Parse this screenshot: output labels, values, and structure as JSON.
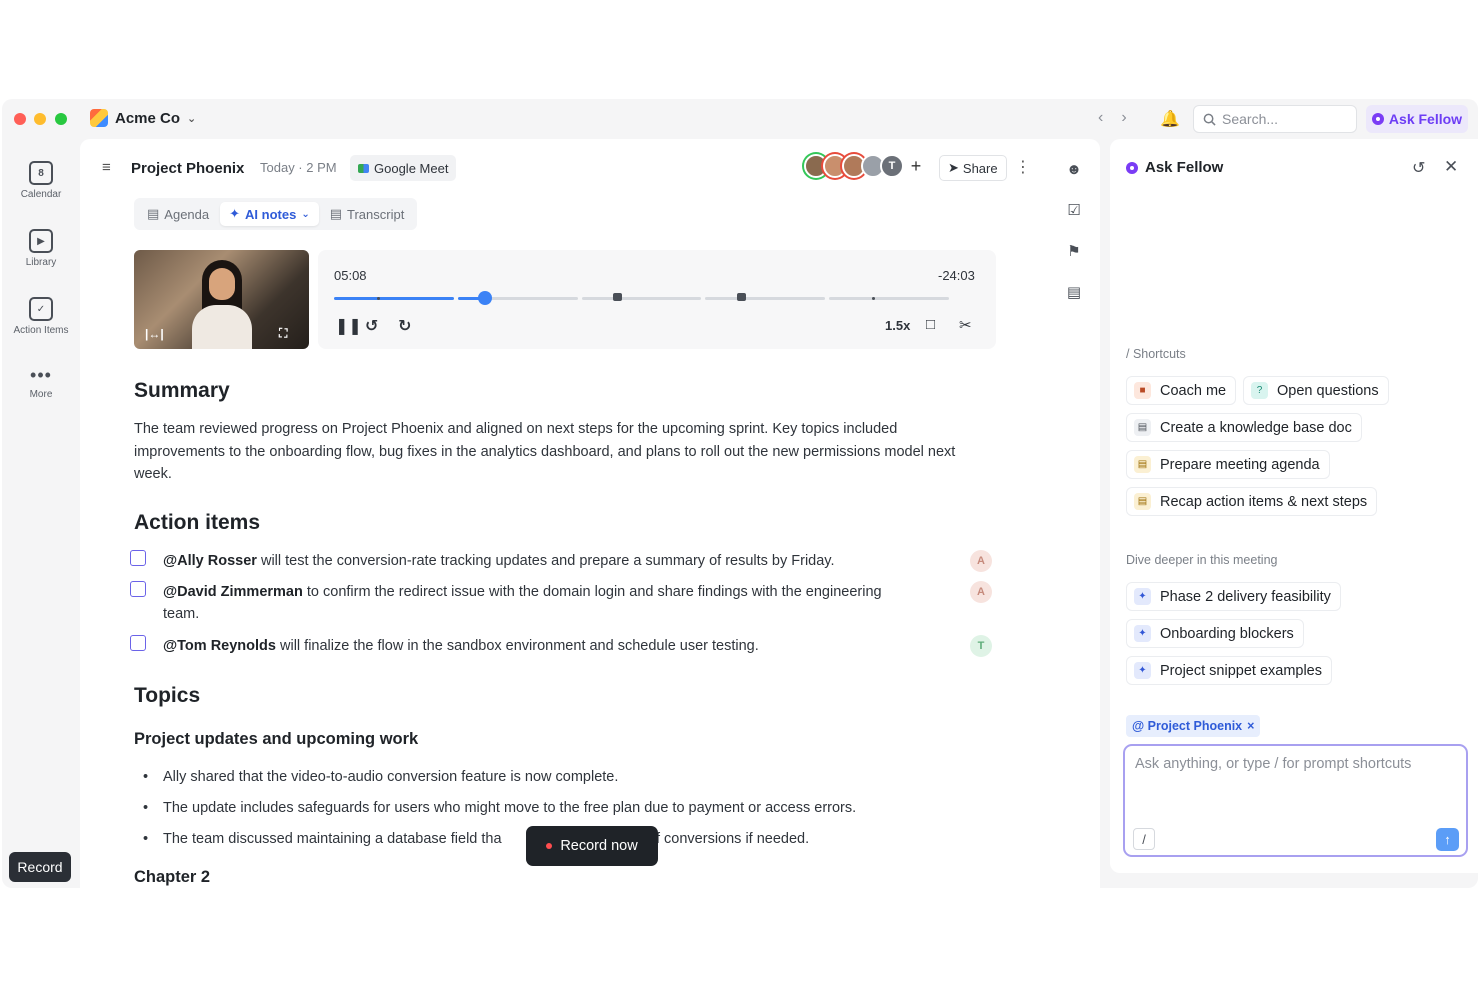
{
  "titlebar": {
    "org_name": "Acme Co",
    "search_placeholder": "Search...",
    "ask_button": "Ask Fellow"
  },
  "rail": {
    "items": [
      {
        "label": "Calendar",
        "icon": "calendar-icon",
        "badge": "8"
      },
      {
        "label": "Library",
        "icon": "library-icon"
      },
      {
        "label": "Action Items",
        "icon": "checkbox-icon"
      },
      {
        "label": "More",
        "icon": "more-dots-icon"
      }
    ],
    "record_button": "Record"
  },
  "meeting": {
    "title": "Project Phoenix",
    "time": "Today · 2 PM",
    "platform": "Google Meet",
    "avatar_initial": "T",
    "share_label": "Share"
  },
  "tabs": [
    {
      "label": "Agenda",
      "active": false
    },
    {
      "label": "AI notes",
      "active": true
    },
    {
      "label": "Transcript",
      "active": false
    }
  ],
  "player": {
    "elapsed": "05:08",
    "remaining": "-24:03",
    "speed": "1.5x",
    "progress": 0.24
  },
  "summary": {
    "heading": "Summary",
    "text": "The team reviewed progress on Project Phoenix and aligned on next steps for the upcoming sprint. Key topics included improvements to the onboarding flow, bug fixes in the analytics dashboard, and plans to roll out the new permissions model next week."
  },
  "action_items": {
    "heading": "Action items",
    "items": [
      {
        "mention": "@Ally Rosser",
        "text": " will test the conversion-rate tracking updates and prepare a summary of results by Friday."
      },
      {
        "mention": "@David Zimmerman",
        "text": " to confirm the redirect issue with the domain login and share findings with the engineering team."
      },
      {
        "mention": "@Tom Reynolds",
        "text": " will finalize the flow in the sandbox environment and schedule user testing."
      }
    ]
  },
  "topics": {
    "heading": "Topics",
    "subheading": "Project updates and upcoming work",
    "bullets": [
      "Ally shared that the video-to-audio conversion feature is now complete.",
      "The update includes safeguards for users who might move to the free plan due to payment or access errors.",
      "The team discussed maintaining a database field tha",
      "f conversions if needed."
    ],
    "next_heading": "Chapter 2"
  },
  "record_now": "Record now",
  "panel": {
    "title": "Ask Fellow",
    "shortcuts_label": "/ Shortcuts",
    "shortcuts": [
      {
        "label": "Coach me",
        "icon": "coach-icon"
      },
      {
        "label": "Open questions",
        "icon": "question-icon"
      },
      {
        "label": "Create a knowledge base doc",
        "icon": "document-icon"
      },
      {
        "label": "Prepare meeting agenda",
        "icon": "agenda-icon"
      },
      {
        "label": "Recap action items & next steps",
        "icon": "recap-icon"
      }
    ],
    "dive_label": "Dive deeper in this meeting",
    "dive_items": [
      {
        "label": "Phase 2 delivery feasibility",
        "icon": "sparkle-icon"
      },
      {
        "label": "Onboarding blockers",
        "icon": "sparkle-icon"
      },
      {
        "label": "Project snippet examples",
        "icon": "sparkle-icon"
      }
    ],
    "context_tag": "@ Project Phoenix",
    "prompt_placeholder": "Ask anything, or type / for prompt shortcuts"
  },
  "colors": {
    "accent": "#6d3df5",
    "link_blue": "#2f5bd8",
    "progress_blue": "#3b82f6",
    "record_red": "#ff4d4f"
  }
}
